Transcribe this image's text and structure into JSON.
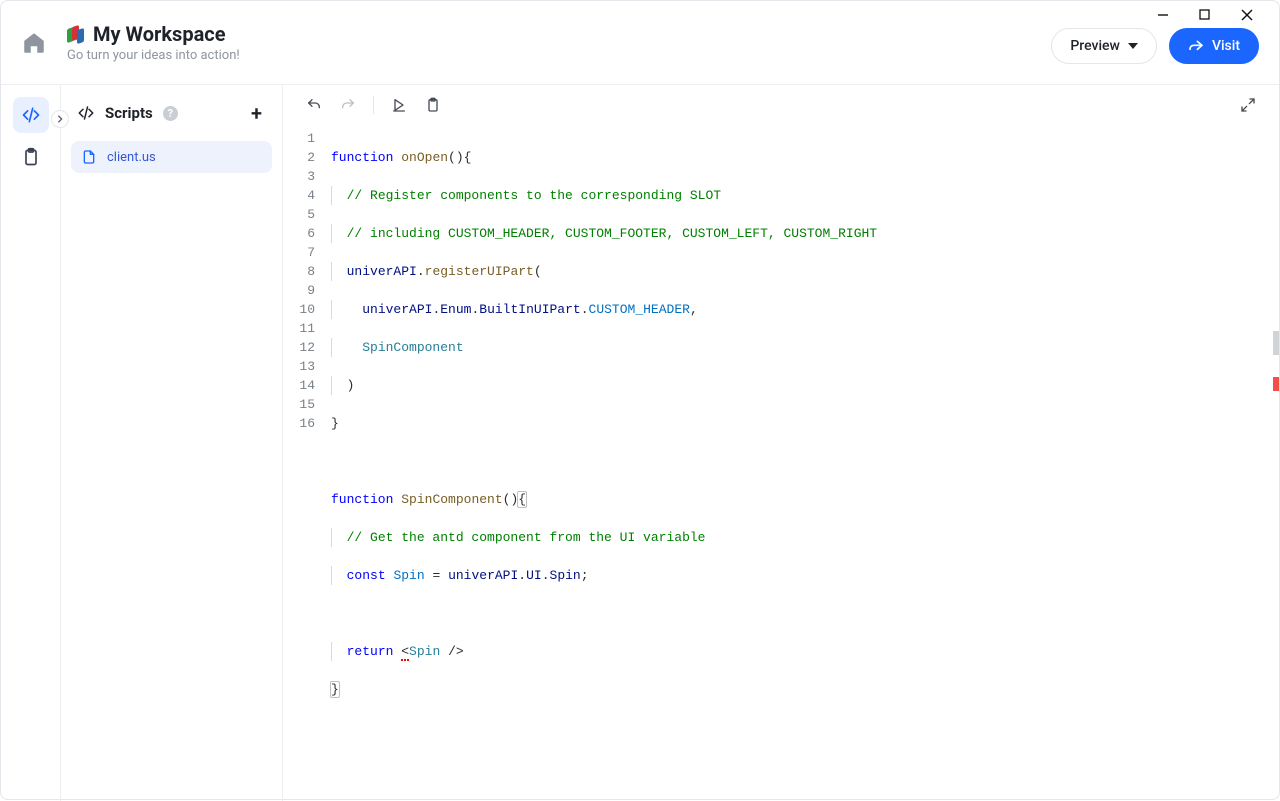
{
  "window": {
    "minimize": "—",
    "maximize": "□",
    "close": "✕"
  },
  "header": {
    "title": "My Workspace",
    "subtitle": "Go turn your ideas into action!",
    "preview_label": "Preview",
    "visit_label": "Visit"
  },
  "rail": {
    "code_label": "Scripts",
    "tasks_label": "Tasks"
  },
  "sidebar": {
    "title": "Scripts",
    "help": "?",
    "add": "+",
    "files": [
      {
        "name": "client.us"
      }
    ]
  },
  "toolbar": {
    "undo": "Undo",
    "redo": "Redo",
    "run": "Run",
    "tasks": "Tasks",
    "expand": "Expand"
  },
  "editor": {
    "line_count": 16,
    "lines": {
      "l1_kw": "function",
      "l1_fn": "onOpen",
      "l1_rest": "(){",
      "l2": "// Register components to the corresponding SLOT",
      "l3": "// including CUSTOM_HEADER, CUSTOM_FOOTER, CUSTOM_LEFT, CUSTOM_RIGHT",
      "l4_obj": "univerAPI",
      "l4_m": "registerUIPart",
      "l4_rest": "(",
      "l5_obj": "univerAPI",
      "l5_p1": "Enum",
      "l5_p2": "BuiltInUIPart",
      "l5_p3": "CUSTOM_HEADER",
      "l5_rest": ",",
      "l6": "SpinComponent",
      "l7": ")",
      "l8": "}",
      "l10_kw": "function",
      "l10_fn": "SpinComponent",
      "l10_paren": "()",
      "l10_brace": "{",
      "l11": "// Get the antd component from the UI variable",
      "l12_kw": "const",
      "l12_var": "Spin",
      "l12_eq": " = ",
      "l12_obj": "univerAPI",
      "l12_p1": "UI",
      "l12_p2": "Spin",
      "l12_end": ";",
      "l14_kw": "return",
      "l14_sp": " ",
      "l14_lt": "<",
      "l14_tag": "Spin",
      "l14_end": " />",
      "l15": "}"
    }
  }
}
